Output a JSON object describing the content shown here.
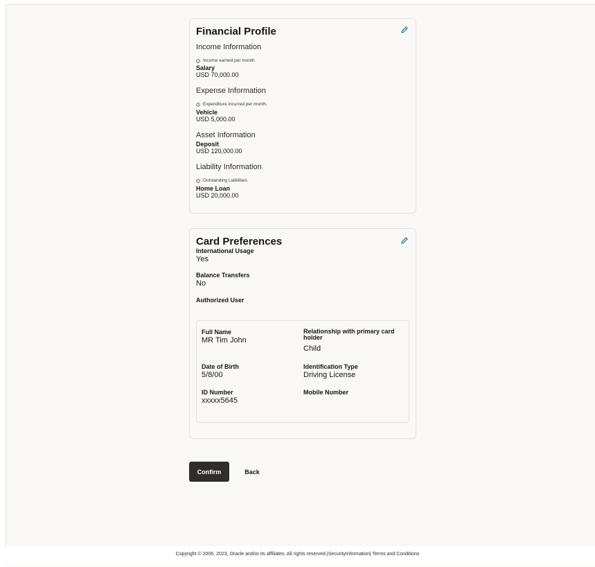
{
  "financial_profile": {
    "title": "Financial Profile",
    "income": {
      "heading": "Income Information",
      "info": "Income earned per month.",
      "label": "Salary",
      "value": "USD 70,000.00"
    },
    "expense": {
      "heading": "Expense Information",
      "info": "Expenditure incurred per month.",
      "label": "Vehicle",
      "value": "USD 5,000.00"
    },
    "asset": {
      "heading": "Asset Information",
      "label": "Deposit",
      "value": "USD 120,000.00"
    },
    "liability": {
      "heading": "Liability Information",
      "info": "Outstanding Liabilities.",
      "label": "Home Loan",
      "value": "USD 20,000.00"
    }
  },
  "card_preferences": {
    "title": "Card Preferences",
    "international_usage": {
      "label": "International Usage",
      "value": "Yes"
    },
    "balance_transfers": {
      "label": "Balance Transfers",
      "value": "No"
    },
    "authorized_user": {
      "label": "Authorized User",
      "full_name": {
        "label": "Full Name",
        "value": "MR Tim John"
      },
      "relationship": {
        "label": "Relationship with primary card holder",
        "value": "Child"
      },
      "dob": {
        "label": "Date of Birth",
        "value": "5/8/00"
      },
      "id_type": {
        "label": "Identification Type",
        "value": "Driving License"
      },
      "id_number": {
        "label": "ID Number",
        "value": "xxxxx5645"
      },
      "mobile": {
        "label": "Mobile Number",
        "value": ""
      }
    }
  },
  "actions": {
    "confirm": "Confirm",
    "back": "Back"
  },
  "footer": {
    "text": "Copyright © 2006, 2023, Oracle and/or its affiliates. All rights reserved.|SecurityInformation| Terms and Conditions"
  },
  "icons": {
    "edit": "pencil-icon",
    "info": "info-circle-icon"
  },
  "colors": {
    "primary_button": "#312d2a",
    "edit_icon": "#227e9e",
    "background": "#f9f8f6"
  }
}
